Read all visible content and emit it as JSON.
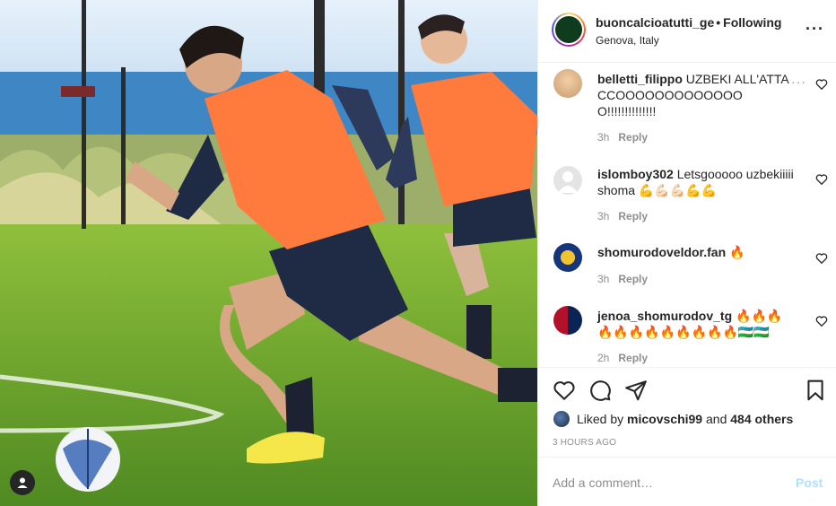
{
  "post": {
    "username": "buoncalcioatutti_ge",
    "separator": "•",
    "follow_label": "Following",
    "location": "Genova, Italy",
    "more_label": "···"
  },
  "comments": [
    {
      "username": "belletti_filippo",
      "text": "UZBEKI ALL'ATTACCOOOOOOOOOOOOOO!!!!!!!!!!!!!!",
      "time": "3h",
      "reply_label": "Reply",
      "more_label": "···"
    },
    {
      "username": "islomboy302",
      "text": "Letsgooooo uzbekiiiii shoma",
      "emoji": "💪💪🏻💪🏻💪💪",
      "time": "3h",
      "reply_label": "Reply"
    },
    {
      "username": "shomurodoveldor.fan",
      "text": "",
      "emoji": "🔥",
      "time": "3h",
      "reply_label": "Reply"
    },
    {
      "username": "jenoa_shomurodov_tg",
      "text": "",
      "emoji": "🔥🔥🔥🔥🔥🔥🔥🔥🔥🔥🔥🔥🇺🇿🇺🇿",
      "time": "2h",
      "reply_label": "Reply"
    }
  ],
  "likes": {
    "prefix": "Liked by",
    "user": "micovschi99",
    "middle": "and",
    "others": "484 others"
  },
  "timestamp": "3 HOURS AGO",
  "comment_box": {
    "placeholder": "Add a comment…",
    "post_label": "Post"
  },
  "icons": [
    "heart-icon",
    "comment-icon",
    "share-icon",
    "bookmark-icon",
    "user-tag-icon"
  ],
  "colors": {
    "accent_disabled": "#b2dffc",
    "muted": "#8e8e8e",
    "text": "#262626",
    "bib_orange": "#ff7a3d"
  }
}
